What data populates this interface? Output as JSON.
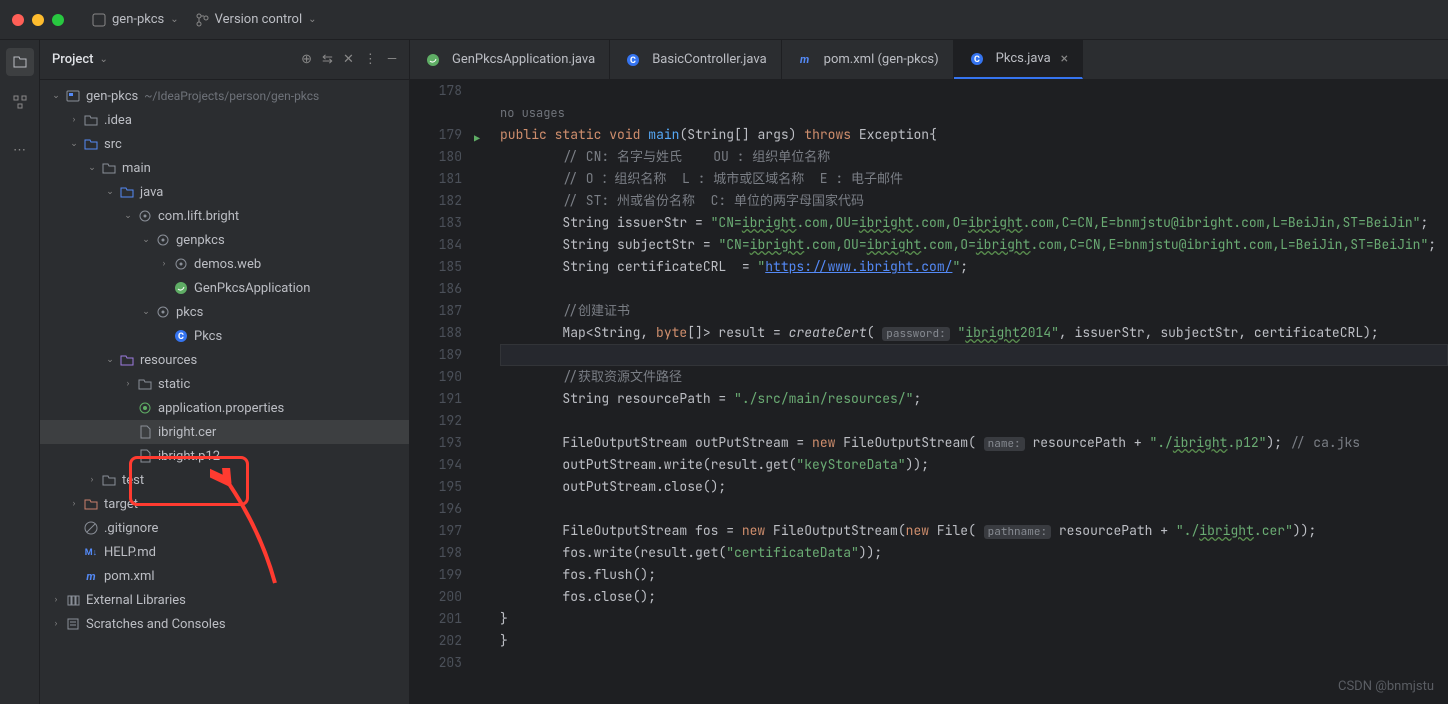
{
  "topbar": {
    "project_name": "gen-pkcs",
    "vcs_label": "Version control"
  },
  "project_panel": {
    "title": "Project",
    "items": [
      {
        "indent": 0,
        "arrow": "v",
        "icon": "module",
        "label": "gen-pkcs",
        "path": "~/IdeaProjects/person/gen-pkcs"
      },
      {
        "indent": 1,
        "arrow": ">",
        "icon": "folder",
        "label": ".idea"
      },
      {
        "indent": 1,
        "arrow": "v",
        "icon": "folder-src",
        "label": "src"
      },
      {
        "indent": 2,
        "arrow": "v",
        "icon": "folder",
        "label": "main"
      },
      {
        "indent": 3,
        "arrow": "v",
        "icon": "folder-src",
        "label": "java"
      },
      {
        "indent": 4,
        "arrow": "v",
        "icon": "package",
        "label": "com.lift.bright"
      },
      {
        "indent": 5,
        "arrow": "v",
        "icon": "package",
        "label": "genpkcs"
      },
      {
        "indent": 6,
        "arrow": ">",
        "icon": "package",
        "label": "demos.web"
      },
      {
        "indent": 6,
        "arrow": "",
        "icon": "spring",
        "label": "GenPkcsApplication"
      },
      {
        "indent": 5,
        "arrow": "v",
        "icon": "package",
        "label": "pkcs"
      },
      {
        "indent": 6,
        "arrow": "",
        "icon": "class",
        "label": "Pkcs"
      },
      {
        "indent": 3,
        "arrow": "v",
        "icon": "folder-res",
        "label": "resources"
      },
      {
        "indent": 4,
        "arrow": ">",
        "icon": "folder",
        "label": "static"
      },
      {
        "indent": 4,
        "arrow": "",
        "icon": "props",
        "label": "application.properties"
      },
      {
        "indent": 4,
        "arrow": "",
        "icon": "file",
        "label": "ibright.cer",
        "highlight": true
      },
      {
        "indent": 4,
        "arrow": "",
        "icon": "file",
        "label": "ibright.p12"
      },
      {
        "indent": 2,
        "arrow": ">",
        "icon": "folder",
        "label": "test"
      },
      {
        "indent": 1,
        "arrow": ">",
        "icon": "folder-excl",
        "label": "target"
      },
      {
        "indent": 1,
        "arrow": "",
        "icon": "gitignore",
        "label": ".gitignore"
      },
      {
        "indent": 1,
        "arrow": "",
        "icon": "md",
        "label": "HELP.md"
      },
      {
        "indent": 1,
        "arrow": "",
        "icon": "maven",
        "label": "pom.xml"
      },
      {
        "indent": 0,
        "arrow": ">",
        "icon": "lib",
        "label": "External Libraries"
      },
      {
        "indent": 0,
        "arrow": ">",
        "icon": "scratch",
        "label": "Scratches and Consoles"
      }
    ]
  },
  "tabs": [
    {
      "icon": "spring",
      "label": "GenPkcsApplication.java"
    },
    {
      "icon": "class",
      "label": "BasicController.java"
    },
    {
      "icon": "maven",
      "label": "pom.xml (gen-pkcs)"
    },
    {
      "icon": "class",
      "label": "Pkcs.java",
      "active": true
    }
  ],
  "editor": {
    "usage_hint": "no usages",
    "lines": [
      {
        "num": 178,
        "html": ""
      },
      {
        "num": 179,
        "run": true,
        "html": "<span class='kw'>public</span> <span class='kw'>static</span> <span class='kw'>void</span> <span class='fn'>main</span>(String[] args) <span class='kw'>throws</span> Exception{"
      },
      {
        "num": 180,
        "html": "    <span class='comment'>// CN: 名字与姓氏    OU : 组织单位名称</span>"
      },
      {
        "num": 181,
        "html": "    <span class='comment'>// O ：组织名称  L : 城市或区域名称  E : 电子邮件</span>"
      },
      {
        "num": 182,
        "html": "    <span class='comment'>// ST: 州或省份名称  C: 单位的两字母国家代码</span>"
      },
      {
        "num": 183,
        "html": "    String <span class='type'>issuerStr</span> = <span class='str'>\"CN=<span class='underline'>ibright</span>.com,OU=<span class='underline'>ibright</span>.com,O=<span class='underline'>ibright</span>.com,C=CN,E=bnmjstu@ibright.com,L=BeiJin,ST=BeiJin\"</span>;"
      },
      {
        "num": 184,
        "html": "    String <span class='type'>subjectStr</span> = <span class='str'>\"CN=<span class='underline'>ibright</span>.com,OU=<span class='underline'>ibright</span>.com,O=<span class='underline'>ibright</span>.com,C=CN,E=bnmjstu@ibright.com,L=BeiJin,ST=BeiJin\"</span>;"
      },
      {
        "num": 185,
        "html": "    String <span class='type'>certificateCRL</span>  = <span class='str'>\"<span class='link'>https://www.ibright.com/</span>\"</span>;"
      },
      {
        "num": 186,
        "html": ""
      },
      {
        "num": 187,
        "html": "    <span class='comment'>//创建证书</span>"
      },
      {
        "num": 188,
        "html": "    Map&lt;String, <span class='kw'>byte</span>[]&gt; <span class='type'>result</span> = <span style='font-style:italic'>createCert</span>( <span class='param-hint'>password:</span> <span class='str'>\"<span class='underline'>ibright</span>2014\"</span>, issuerStr, subjectStr, certificateCRL);"
      },
      {
        "num": 189,
        "hl": true,
        "html": ""
      },
      {
        "num": 190,
        "html": "    <span class='comment'>//获取资源文件路径</span>"
      },
      {
        "num": 191,
        "html": "    String <span class='type'>resourcePath</span> = <span class='str'>\"./src/main/resources/\"</span>;"
      },
      {
        "num": 192,
        "html": ""
      },
      {
        "num": 193,
        "html": "    FileOutputStream <span class='type'>outPutStream</span> = <span class='kw'>new</span> FileOutputStream( <span class='param-hint'>name:</span> resourcePath + <span class='str'>\"./<span class='underline'>ibright</span>.p12\"</span>); <span class='comment'>// ca.jks</span>"
      },
      {
        "num": 194,
        "html": "    outPutStream.write(result.get(<span class='str'>\"keyStoreData\"</span>));"
      },
      {
        "num": 195,
        "html": "    outPutStream.close();"
      },
      {
        "num": 196,
        "html": ""
      },
      {
        "num": 197,
        "html": "    FileOutputStream <span class='type'>fos</span> = <span class='kw'>new</span> FileOutputStream(<span class='kw'>new</span> File( <span class='param-hint'>pathname:</span> resourcePath + <span class='str'>\"./<span class='underline'>ibright</span>.cer\"</span>));"
      },
      {
        "num": 198,
        "html": "    fos.write(result.get(<span class='str'>\"certificateData\"</span>));"
      },
      {
        "num": 199,
        "html": "    fos.flush();"
      },
      {
        "num": 200,
        "html": "    fos.close();"
      },
      {
        "num": 201,
        "html": "}"
      },
      {
        "num": 202,
        "html": "}",
        "outdent": true
      },
      {
        "num": 203,
        "html": ""
      }
    ]
  },
  "watermark": "CSDN @bnmjstu"
}
